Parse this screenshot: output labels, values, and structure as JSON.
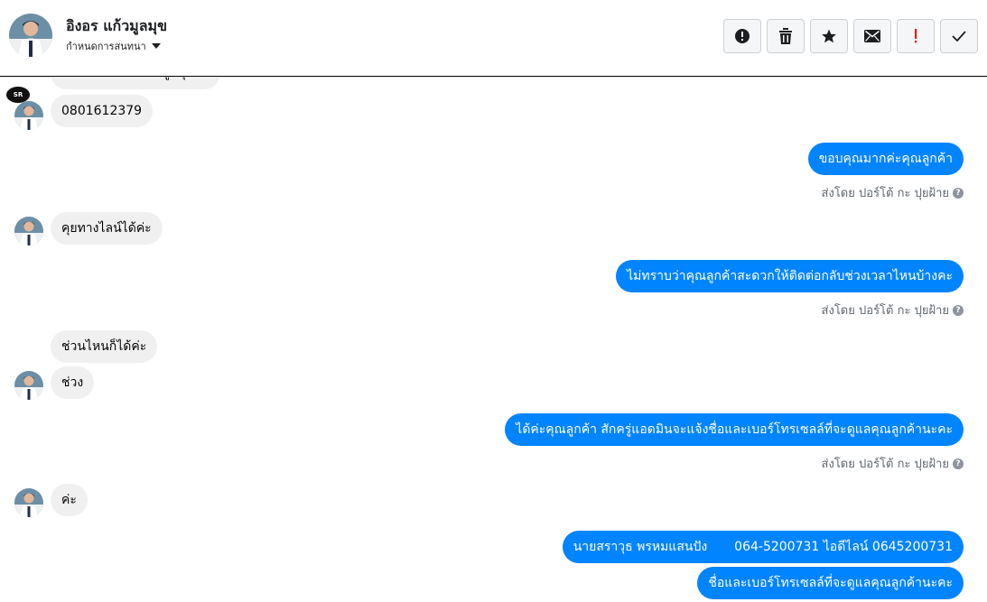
{
  "header": {
    "contact_name": "อิงอร แก้วมูลมุข",
    "assign_label": "กำหนดการสนทนา",
    "actions": [
      {
        "name": "spam-button",
        "icon": "exclamation-circle-icon"
      },
      {
        "name": "delete-button",
        "icon": "trash-icon"
      },
      {
        "name": "star-button",
        "icon": "star-icon"
      },
      {
        "name": "mark-unread-button",
        "icon": "envelope-icon"
      },
      {
        "name": "follow-up-button",
        "icon": "red-exclamation-icon"
      },
      {
        "name": "mark-done-button",
        "icon": "checkmark-icon"
      }
    ]
  },
  "colors": {
    "outgoing_bubble": "#0084ff",
    "incoming_bubble": "#f0f0f0",
    "follow_up_icon": "#e02020"
  },
  "messages": {
    "partial_top": "ไอดีไลน์อิงอร แก้วมูลมุขค่ะ",
    "sticker_label": "SR",
    "m1": "0801612379",
    "m2": "ขอบคุณมากค่ะคุณลูกค้า",
    "m3": "คุยทางไลน์ได้ค่ะ",
    "m4": "ไม่ทราบว่าคุณลูกค้าสะดวกให้ติดต่อกลับช่วงเวลาไหนบ้างคะ",
    "m5": "ช่วนไหนก็ได้ค่ะ",
    "m6": "ช่วง",
    "m7": "ได้ค่ะคุณลูกค้า สักครู่แอดมินจะแจ้งชื่อและเบอร์โทรเซลล์ที่จะดูแลคุณลูกค้านะคะ",
    "m8": "ค่ะ",
    "m9_name": "นายสราวุธ พรหมแสนปัง",
    "m9_contact": "064-5200731 ไอดีไลน์ 0645200731",
    "m10": "ชื่อและเบอร์โทรเซลล์ที่จะดูแลคุณลูกค้านะคะ"
  },
  "sent_by": "ส่งโดย ปอร์โต้ กะ ปุยฝ้าย",
  "help_glyph": "?"
}
